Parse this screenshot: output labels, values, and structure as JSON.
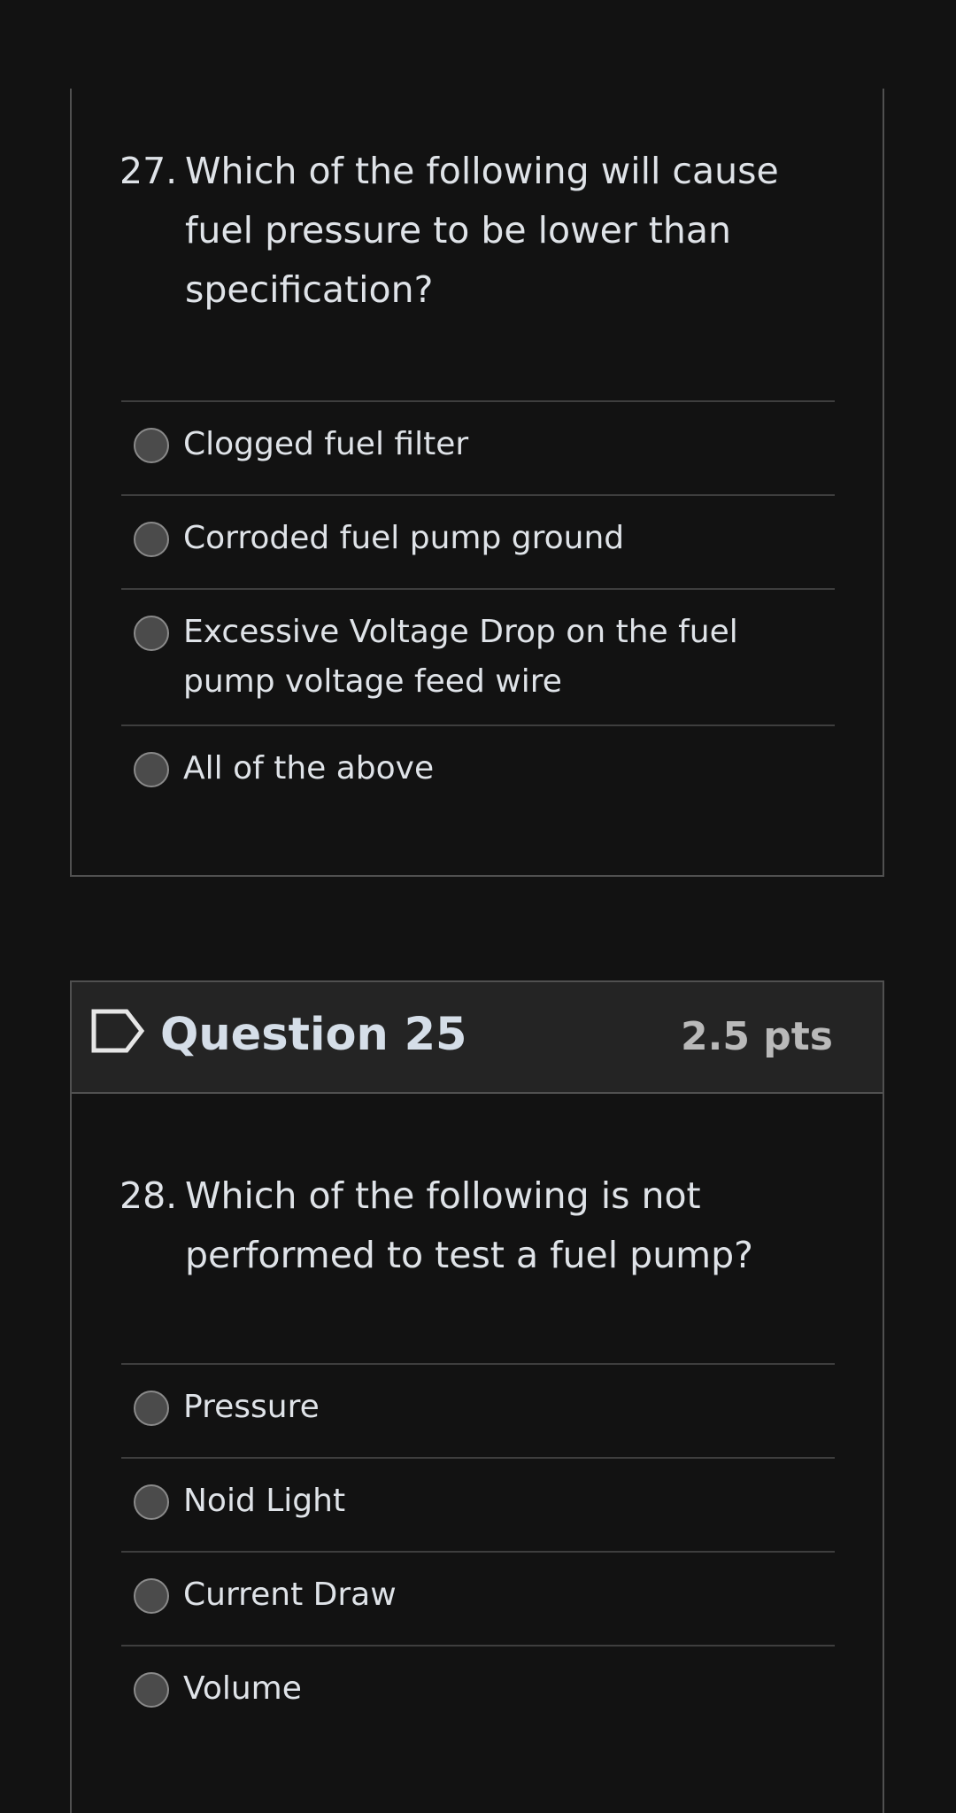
{
  "questions": [
    {
      "number": "27.",
      "text": "Which of the following will cause fuel pressure to be lower than specification?",
      "answers": [
        "Clogged fuel filter",
        "Corroded fuel pump ground",
        "Excessive Voltage Drop on the fuel pump voltage feed wire",
        "All of the above"
      ]
    },
    {
      "header": "Question 25",
      "points": "2.5 pts",
      "flag_icon": "flag-outline-icon",
      "number": "28.",
      "text": "Which of the following is not performed to test a fuel pump?",
      "answers": [
        "Pressure",
        "Noid Light",
        "Current Draw",
        "Volume"
      ]
    }
  ],
  "colors": {
    "background": "#121212",
    "header_background": "#242424",
    "border": "#505050",
    "text": "#dfe3e8",
    "points": "#b9b9b9"
  }
}
